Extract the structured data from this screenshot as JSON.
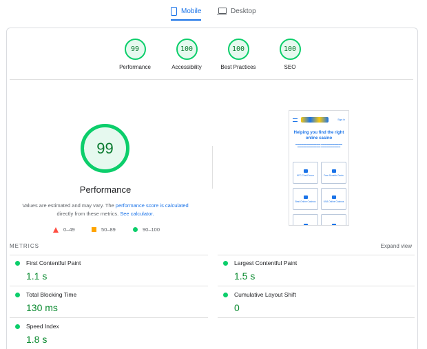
{
  "tabs": {
    "mobile": "Mobile",
    "desktop": "Desktop"
  },
  "summary": [
    {
      "score": "99",
      "label": "Performance"
    },
    {
      "score": "100",
      "label": "Accessibility"
    },
    {
      "score": "100",
      "label": "Best Practices"
    },
    {
      "score": "100",
      "label": "SEO"
    }
  ],
  "performance": {
    "score": "99",
    "title": "Performance",
    "desc_prefix": "Values are estimated and may vary. The ",
    "desc_link": "performance score is calculated",
    "desc_mid": " directly from these metrics. ",
    "desc_link2": "See calculator."
  },
  "legend": {
    "fail": "0–49",
    "average": "50–89",
    "pass": "90–100"
  },
  "screenshot": {
    "signin": "Sign in",
    "heading": "Helping you find the right online casino",
    "tiles": [
      "KFC Chat Forum",
      "Free Scratch Cards",
      "Best Online Casinos",
      "USA Online Casinos"
    ]
  },
  "metrics": {
    "title": "METRICS",
    "expand": "Expand view",
    "fcp": {
      "name": "First Contentful Paint",
      "value": "1.1 s"
    },
    "lcp": {
      "name": "Largest Contentful Paint",
      "value": "1.5 s"
    },
    "tbt": {
      "name": "Total Blocking Time",
      "value": "130 ms"
    },
    "cls": {
      "name": "Cumulative Layout Shift",
      "value": "0"
    },
    "si": {
      "name": "Speed Index",
      "value": "1.8 s"
    }
  },
  "colors": {
    "pass": "#0cce6b",
    "average": "#ffa400",
    "fail": "#ff4e42",
    "accent": "#1a73e8"
  }
}
